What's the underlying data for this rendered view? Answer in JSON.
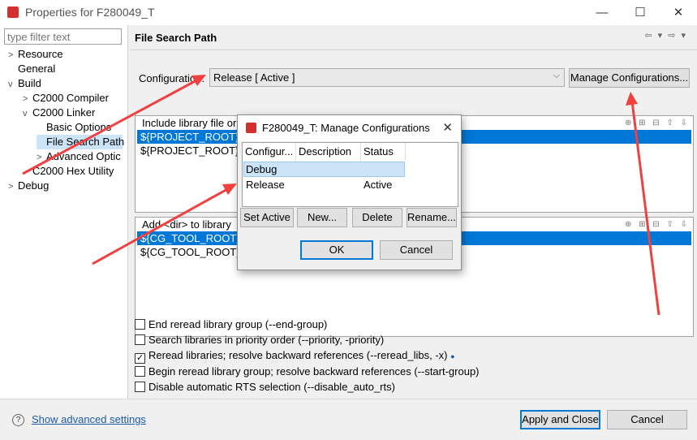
{
  "window": {
    "title": "Properties for F280049_T",
    "minimize": "—",
    "maximize": "☐",
    "close": "✕"
  },
  "sidebar": {
    "filter_placeholder": "type filter text",
    "items": [
      {
        "label": "Resource",
        "toggle": ">"
      },
      {
        "label": "General",
        "toggle": ""
      },
      {
        "label": "Build",
        "toggle": "v"
      },
      {
        "label": "C2000 Compiler",
        "toggle": ">"
      },
      {
        "label": "C2000 Linker",
        "toggle": "v"
      },
      {
        "label": "Basic Options",
        "toggle": ""
      },
      {
        "label": "File Search Path",
        "toggle": ""
      },
      {
        "label": "Advanced Optic",
        "toggle": ">"
      },
      {
        "label": "C2000 Hex Utility",
        "toggle": ""
      },
      {
        "label": "Debug",
        "toggle": ">"
      }
    ],
    "selected": "File Search Path"
  },
  "main": {
    "title": "File Search Path",
    "config_label": "Configuration:",
    "config_value": "Release  [ Active ]",
    "manage_button": "Manage Configurations...",
    "include_list": {
      "header": "Include library file or",
      "rows": [
        "${PROJECT_ROOT}/rts",
        "${PROJECT_ROOT}/rts"
      ]
    },
    "search_list": {
      "header": "Add <dir> to library",
      "rows": [
        "${CG_TOOL_ROOT}/lib",
        "${CG_TOOL_ROOT}/in"
      ]
    },
    "checkboxes": [
      {
        "label": "End reread library group (--end-group)",
        "checked": false
      },
      {
        "label": "Search libraries in priority order (--priority, -priority)",
        "checked": false
      },
      {
        "label": "Reread libraries; resolve backward references (--reread_libs, -x)",
        "checked": true
      },
      {
        "label": "Begin reread library group; resolve backward references (--start-group)",
        "checked": false
      },
      {
        "label": "Disable automatic RTS selection (--disable_auto_rts)",
        "checked": false
      }
    ]
  },
  "dialog": {
    "title": "F280049_T: Manage Configurations",
    "columns": [
      "Configur...",
      "Description",
      "Status"
    ],
    "rows": [
      {
        "name": "Debug",
        "description": "",
        "status": ""
      },
      {
        "name": "Release",
        "description": "",
        "status": "Active"
      }
    ],
    "buttons": {
      "set_active": "Set Active",
      "new": "New...",
      "delete": "Delete",
      "rename": "Rename..."
    },
    "ok": "OK",
    "cancel": "Cancel"
  },
  "footer": {
    "help": "?",
    "advanced_link": "Show advanced settings",
    "apply_close": "Apply and Close",
    "cancel": "Cancel"
  },
  "colors": {
    "selection": "#0078d7",
    "annotation_arrow": "#f04040",
    "link": "#1e5aa8"
  }
}
